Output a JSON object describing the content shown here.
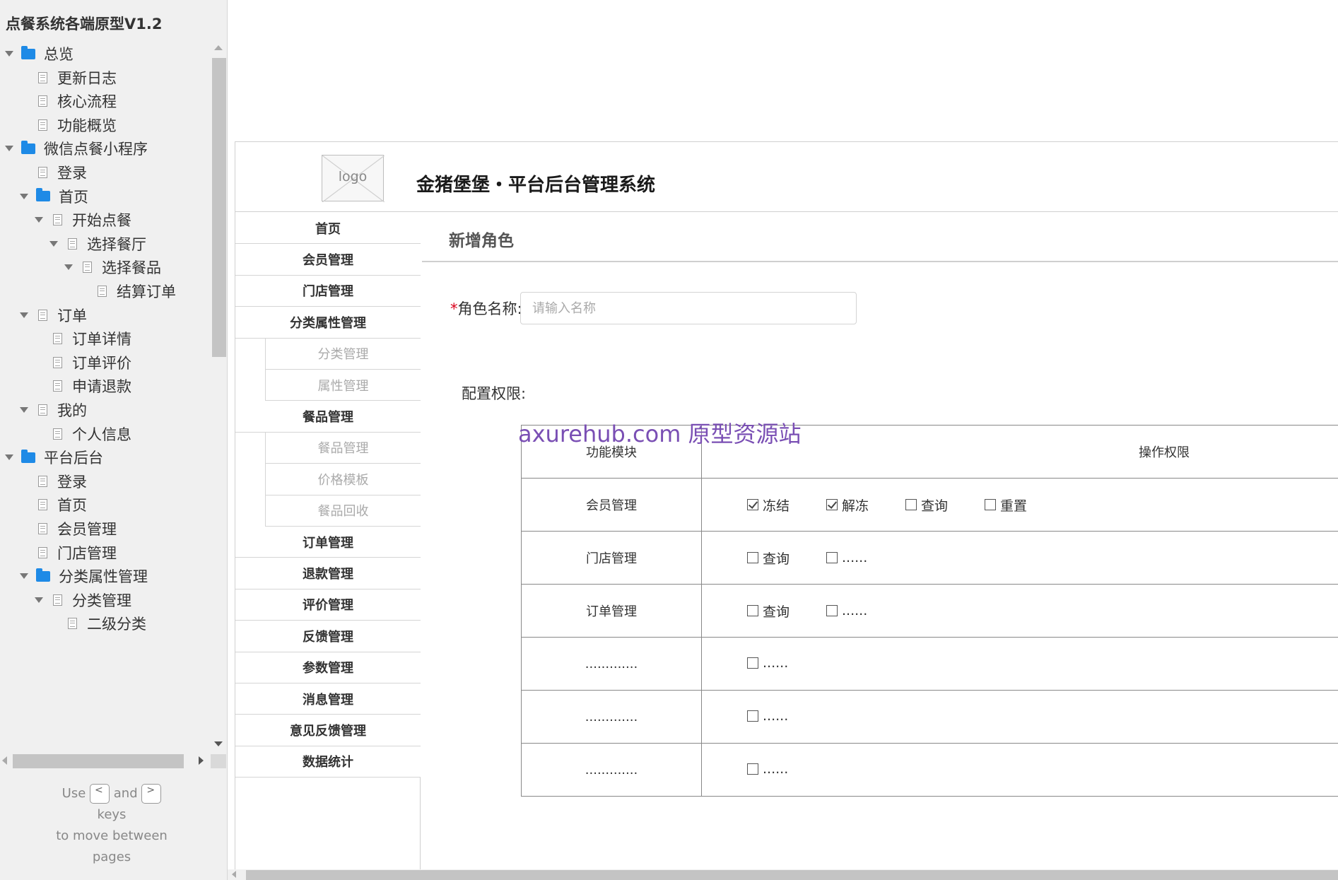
{
  "sidebar": {
    "project_title": "点餐系统各端原型V1.2",
    "tree": [
      {
        "label": "总览",
        "type": "folder",
        "level": 0,
        "expanded": true
      },
      {
        "label": "更新日志",
        "type": "page",
        "level": 1,
        "expanded": false
      },
      {
        "label": "核心流程",
        "type": "page",
        "level": 1,
        "expanded": false
      },
      {
        "label": "功能概览",
        "type": "page",
        "level": 1,
        "expanded": false
      },
      {
        "label": "微信点餐小程序",
        "type": "folder",
        "level": 0,
        "expanded": true
      },
      {
        "label": "登录",
        "type": "page",
        "level": 1,
        "expanded": false
      },
      {
        "label": "首页",
        "type": "folder",
        "level": 1,
        "expanded": true
      },
      {
        "label": "开始点餐",
        "type": "page",
        "level": 2,
        "expanded": true
      },
      {
        "label": "选择餐厅",
        "type": "page",
        "level": 3,
        "expanded": true
      },
      {
        "label": "选择餐品",
        "type": "page",
        "level": 4,
        "expanded": true
      },
      {
        "label": "结算订单",
        "type": "page",
        "level": 5,
        "expanded": false
      },
      {
        "label": "订单",
        "type": "page",
        "level": 1,
        "expanded": true
      },
      {
        "label": "订单详情",
        "type": "page",
        "level": 2,
        "expanded": false
      },
      {
        "label": "订单评价",
        "type": "page",
        "level": 2,
        "expanded": false
      },
      {
        "label": "申请退款",
        "type": "page",
        "level": 2,
        "expanded": false
      },
      {
        "label": "我的",
        "type": "page",
        "level": 1,
        "expanded": true
      },
      {
        "label": "个人信息",
        "type": "page",
        "level": 2,
        "expanded": false
      },
      {
        "label": "平台后台",
        "type": "folder",
        "level": 0,
        "expanded": true
      },
      {
        "label": "登录",
        "type": "page",
        "level": 1,
        "expanded": false
      },
      {
        "label": "首页",
        "type": "page",
        "level": 1,
        "expanded": false
      },
      {
        "label": "会员管理",
        "type": "page",
        "level": 1,
        "expanded": false
      },
      {
        "label": "门店管理",
        "type": "page",
        "level": 1,
        "expanded": false
      },
      {
        "label": "分类属性管理",
        "type": "folder",
        "level": 1,
        "expanded": true
      },
      {
        "label": "分类管理",
        "type": "page",
        "level": 2,
        "expanded": true
      },
      {
        "label": "二级分类",
        "type": "page",
        "level": 3,
        "expanded": false
      }
    ],
    "hint": {
      "use": "Use",
      "prev_key": "<",
      "and": "and",
      "next_key": ">",
      "keys": "keys",
      "line2": "to move between",
      "line3": "pages"
    }
  },
  "app": {
    "logo_text": "logo",
    "system_title": "金猪堡堡・平台后台管理系统",
    "nav": [
      {
        "label": "首页",
        "sub": false
      },
      {
        "label": "会员管理",
        "sub": false
      },
      {
        "label": "门店管理",
        "sub": false
      },
      {
        "label": "分类属性管理",
        "sub": false
      },
      {
        "label": "分类管理",
        "sub": true
      },
      {
        "label": "属性管理",
        "sub": true
      },
      {
        "label": "餐品管理",
        "sub": false
      },
      {
        "label": "餐品管理",
        "sub": true
      },
      {
        "label": "价格模板",
        "sub": true
      },
      {
        "label": "餐品回收",
        "sub": true
      },
      {
        "label": "订单管理",
        "sub": false
      },
      {
        "label": "退款管理",
        "sub": false
      },
      {
        "label": "评价管理",
        "sub": false
      },
      {
        "label": "反馈管理",
        "sub": false
      },
      {
        "label": "参数管理",
        "sub": false
      },
      {
        "label": "消息管理",
        "sub": false
      },
      {
        "label": "意见反馈管理",
        "sub": false
      },
      {
        "label": "数据统计",
        "sub": false
      }
    ],
    "page_heading": "新增角色",
    "form": {
      "required_mark": "*",
      "role_label": "角色名称:",
      "role_placeholder": "请输入名称",
      "role_value": "",
      "perm_label": "配置权限:"
    },
    "watermark": "axurehub.com 原型资源站",
    "perm_table": {
      "headers": [
        "功能模块",
        "操作权限"
      ],
      "rows": [
        {
          "module": "会员管理",
          "ops": [
            {
              "label": "冻结",
              "checked": true
            },
            {
              "label": "解冻",
              "checked": true
            },
            {
              "label": "查询",
              "checked": false
            },
            {
              "label": "重置",
              "checked": false
            }
          ]
        },
        {
          "module": "门店管理",
          "ops": [
            {
              "label": "查询",
              "checked": false
            },
            {
              "label": "......",
              "checked": false
            }
          ]
        },
        {
          "module": "订单管理",
          "ops": [
            {
              "label": "查询",
              "checked": false
            },
            {
              "label": "......",
              "checked": false
            }
          ]
        },
        {
          "module": ".............",
          "ops": [
            {
              "label": "......",
              "checked": false
            }
          ]
        },
        {
          "module": ".............",
          "ops": [
            {
              "label": "......",
              "checked": false
            }
          ]
        },
        {
          "module": ".............",
          "ops": [
            {
              "label": "......",
              "checked": false
            }
          ]
        }
      ]
    }
  },
  "colors": {
    "folder_icon": "#1e8ae6",
    "required": "#d9001b",
    "watermark": "#7a4fb4",
    "panel_bg": "#f0f0f0"
  }
}
